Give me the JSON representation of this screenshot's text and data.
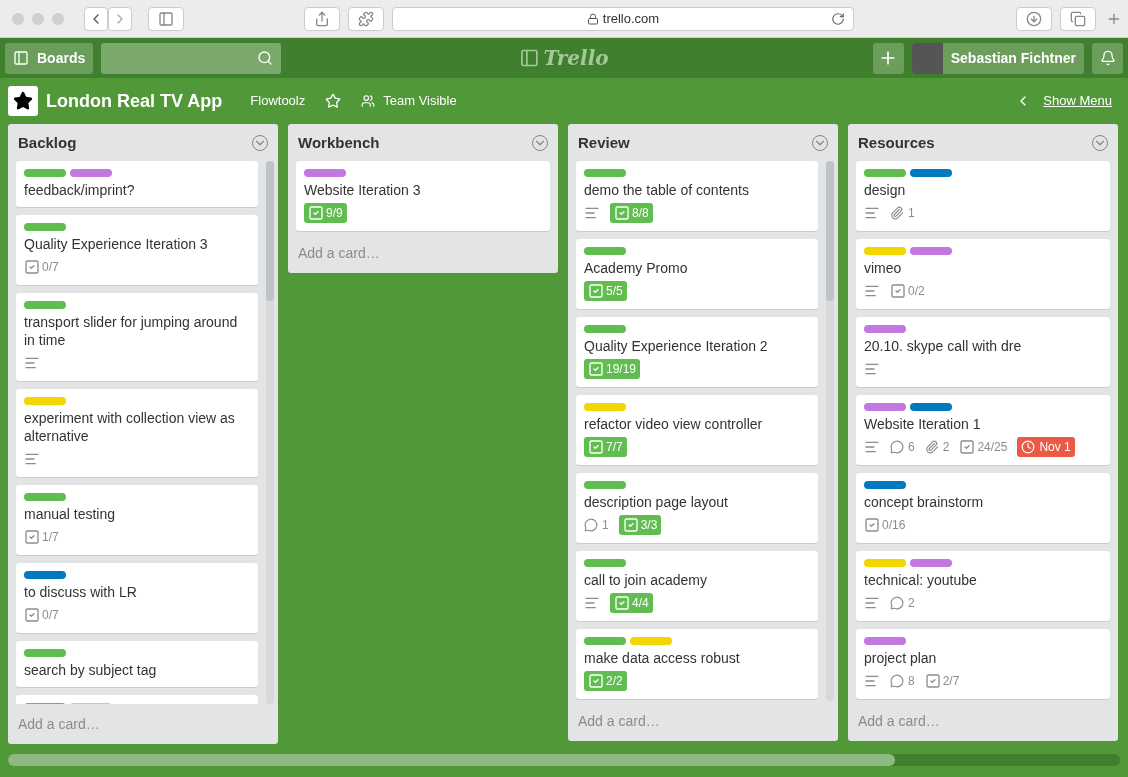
{
  "browser": {
    "url": "trello.com"
  },
  "header": {
    "boards_button": "Boards",
    "logo": "Trello",
    "user_name": "Sebastian Fichtner"
  },
  "board": {
    "title": "London Real TV App",
    "team": "Flowtoolz",
    "starred": false,
    "visibility": "Team Visible",
    "show_menu": "Show Menu"
  },
  "lists": [
    {
      "title": "Backlog",
      "scrollbar": true,
      "add_card": "Add a card…",
      "cards": [
        {
          "labels": [
            {
              "color": "#61bd4f"
            },
            {
              "color": "#c377e0"
            }
          ],
          "title": "feedback/imprint?"
        },
        {
          "labels": [
            {
              "color": "#61bd4f"
            }
          ],
          "title": "Quality Experience Iteration 3",
          "badges": [
            {
              "kind": "checklist",
              "text": "0/7",
              "complete": false
            }
          ]
        },
        {
          "labels": [
            {
              "color": "#61bd4f"
            }
          ],
          "title": "transport slider for jumping around in time",
          "badges": [
            {
              "kind": "description"
            }
          ]
        },
        {
          "labels": [
            {
              "color": "#f2d600"
            }
          ],
          "title": "experiment with collection view as alternative",
          "badges": [
            {
              "kind": "description"
            }
          ]
        },
        {
          "labels": [
            {
              "color": "#61bd4f"
            }
          ],
          "title": "manual testing",
          "badges": [
            {
              "kind": "checklist",
              "text": "1/7",
              "complete": false
            }
          ]
        },
        {
          "labels": [
            {
              "color": "#0079bf"
            }
          ],
          "title": "to discuss with LR",
          "badges": [
            {
              "kind": "checklist",
              "text": "0/7",
              "complete": false
            }
          ]
        },
        {
          "labels": [
            {
              "color": "#61bd4f"
            }
          ],
          "title": "search by subject tag"
        },
        {
          "labels": [
            {
              "color": "#61bd4f"
            },
            {
              "color": "#f2d600"
            }
          ]
        }
      ]
    },
    {
      "title": "Workbench",
      "scrollbar": false,
      "add_card": "Add a card…",
      "cards": [
        {
          "labels": [
            {
              "color": "#c377e0"
            }
          ],
          "title": "Website Iteration 3",
          "badges": [
            {
              "kind": "checklist",
              "text": "9/9",
              "complete": true
            }
          ]
        }
      ]
    },
    {
      "title": "Review",
      "scrollbar": true,
      "add_card": "Add a card…",
      "cards": [
        {
          "labels": [
            {
              "color": "#61bd4f"
            }
          ],
          "title": "demo the table of contents",
          "badges": [
            {
              "kind": "description"
            },
            {
              "kind": "checklist",
              "text": "8/8",
              "complete": true
            }
          ]
        },
        {
          "labels": [
            {
              "color": "#61bd4f"
            }
          ],
          "title": "Academy Promo",
          "badges": [
            {
              "kind": "checklist",
              "text": "5/5",
              "complete": true
            }
          ]
        },
        {
          "labels": [
            {
              "color": "#61bd4f"
            }
          ],
          "title": "Quality Experience Iteration 2",
          "badges": [
            {
              "kind": "checklist",
              "text": "19/19",
              "complete": true
            }
          ]
        },
        {
          "labels": [
            {
              "color": "#f2d600"
            }
          ],
          "title": "refactor video view controller",
          "badges": [
            {
              "kind": "checklist",
              "text": "7/7",
              "complete": true
            }
          ]
        },
        {
          "labels": [
            {
              "color": "#61bd4f"
            }
          ],
          "title": "description page layout",
          "badges": [
            {
              "kind": "comment",
              "text": "1"
            },
            {
              "kind": "checklist",
              "text": "3/3",
              "complete": true
            }
          ]
        },
        {
          "labels": [
            {
              "color": "#61bd4f"
            }
          ],
          "title": "call to join academy",
          "badges": [
            {
              "kind": "description"
            },
            {
              "kind": "checklist",
              "text": "4/4",
              "complete": true
            }
          ]
        },
        {
          "labels": [
            {
              "color": "#61bd4f"
            },
            {
              "color": "#f2d600"
            }
          ],
          "title": "make data access robust",
          "badges": [
            {
              "kind": "checklist",
              "text": "2/2",
              "complete": true
            }
          ]
        }
      ]
    },
    {
      "title": "Resources",
      "scrollbar": false,
      "add_card": "Add a card…",
      "cards": [
        {
          "labels": [
            {
              "color": "#61bd4f"
            },
            {
              "color": "#0079bf"
            }
          ],
          "title": "design",
          "badges": [
            {
              "kind": "description"
            },
            {
              "kind": "attachment",
              "text": "1"
            }
          ]
        },
        {
          "labels": [
            {
              "color": "#f2d600"
            },
            {
              "color": "#c377e0"
            }
          ],
          "title": "vimeo",
          "badges": [
            {
              "kind": "description"
            },
            {
              "kind": "checklist",
              "text": "0/2",
              "complete": false
            }
          ]
        },
        {
          "labels": [
            {
              "color": "#c377e0"
            }
          ],
          "title": "20.10. skype call with dre",
          "badges": [
            {
              "kind": "description"
            }
          ]
        },
        {
          "labels": [
            {
              "color": "#c377e0"
            },
            {
              "color": "#0079bf"
            }
          ],
          "title": "Website Iteration 1",
          "badges": [
            {
              "kind": "description"
            },
            {
              "kind": "comment",
              "text": "6"
            },
            {
              "kind": "attachment",
              "text": "2"
            },
            {
              "kind": "checklist",
              "text": "24/25",
              "complete": false
            },
            {
              "kind": "due",
              "text": "Nov 1",
              "overdue": true
            }
          ]
        },
        {
          "labels": [
            {
              "color": "#0079bf"
            }
          ],
          "title": "concept brainstorm",
          "badges": [
            {
              "kind": "checklist",
              "text": "0/16",
              "complete": false
            }
          ]
        },
        {
          "labels": [
            {
              "color": "#f2d600"
            },
            {
              "color": "#c377e0"
            }
          ],
          "title": "technical: youtube",
          "badges": [
            {
              "kind": "description"
            },
            {
              "kind": "comment",
              "text": "2"
            }
          ]
        },
        {
          "labels": [
            {
              "color": "#c377e0"
            }
          ],
          "title": "project plan",
          "badges": [
            {
              "kind": "description"
            },
            {
              "kind": "comment",
              "text": "8"
            },
            {
              "kind": "checklist",
              "text": "2/7",
              "complete": false
            }
          ]
        }
      ]
    }
  ]
}
